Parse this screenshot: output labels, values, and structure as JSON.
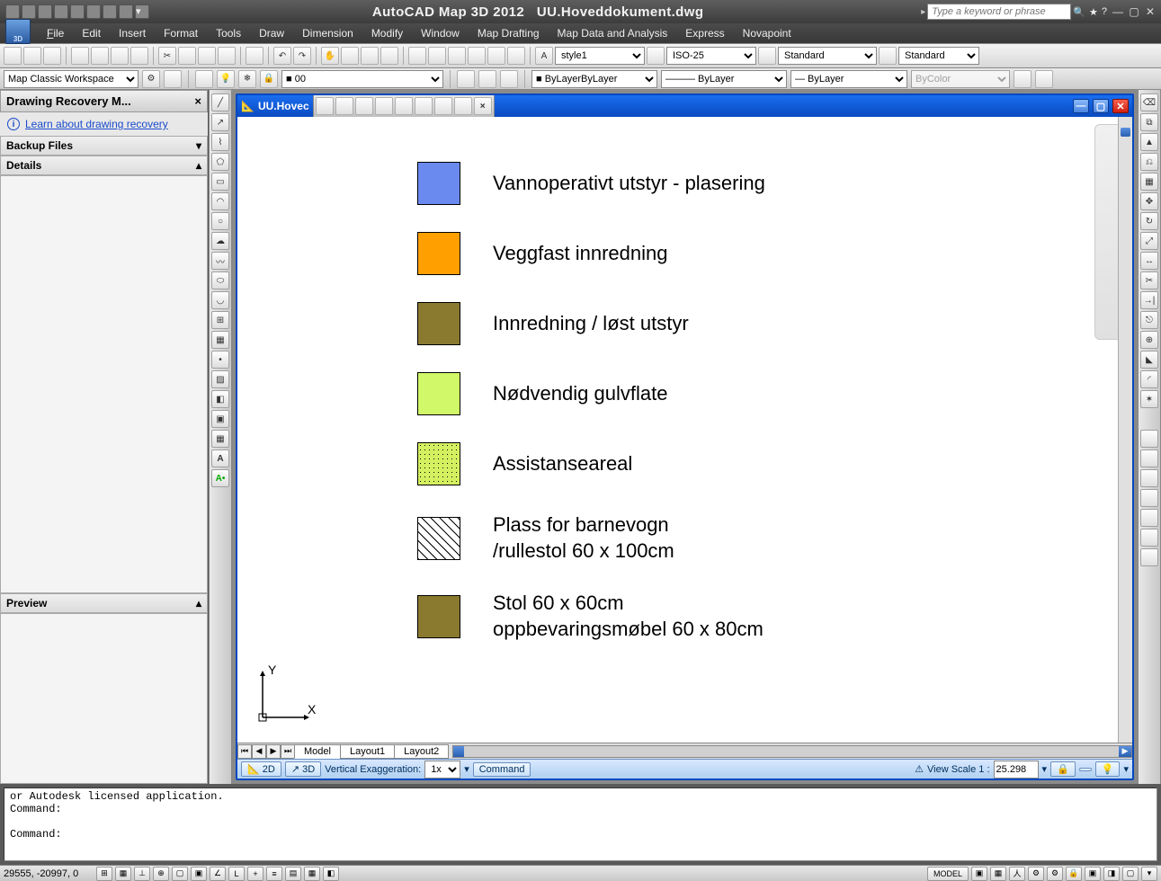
{
  "app": {
    "title_app": "AutoCAD Map 3D 2012",
    "title_file": "UU.Hoveddokument.dwg",
    "search_placeholder": "Type a keyword or phrase",
    "logo3d": "3D"
  },
  "menu": {
    "file": "File",
    "edit": "Edit",
    "insert": "Insert",
    "format": "Format",
    "tools": "Tools",
    "draw": "Draw",
    "dimension": "Dimension",
    "modify": "Modify",
    "window": "Window",
    "map_drafting": "Map Drafting",
    "map_data": "Map Data and Analysis",
    "express": "Express",
    "novapoint": "Novapoint"
  },
  "toolbar2": {
    "text_style": "style1",
    "dim_style": "ISO-25",
    "table_style": "Standard",
    "mleader_style": "Standard"
  },
  "workspace": {
    "name": "Map Classic Workspace",
    "layer_value": "0",
    "layer_control": "ByLayer",
    "linetype": "ByLayer",
    "lineweight": "ByLayer",
    "plot_style": "ByColor"
  },
  "left_panel": {
    "title": "Drawing Recovery M...",
    "link": "Learn about drawing recovery",
    "backup": "Backup Files",
    "details": "Details",
    "preview": "Preview"
  },
  "drawing_window": {
    "title": "UU.Hovec",
    "ucs_y": "Y",
    "ucs_x": "X"
  },
  "legend": {
    "items": [
      {
        "color": "#6a8af0",
        "text": "Vannoperativt utstyr - plasering"
      },
      {
        "color": "#ffa000",
        "text": "Veggfast innredning"
      },
      {
        "color": "#8a7a30",
        "text": "Innredning / løst utstyr"
      },
      {
        "color": "#d0f868",
        "text": "Nødvendig gulvflate"
      },
      {
        "pattern": "dots",
        "text": "Assistanseareal"
      },
      {
        "pattern": "diag",
        "text": "Plass for barnevogn\n/rullestol 60 x 100cm"
      },
      {
        "color": "#8a7a30",
        "text": "Stol 60 x 60cm\noppbevaringsmøbel 60 x 80cm"
      }
    ]
  },
  "layout_tabs": {
    "model": "Model",
    "layout1": "Layout1",
    "layout2": "Layout2"
  },
  "view_controls": {
    "mode2d": "2D",
    "mode3d": "3D",
    "vert_exag_label": "Vertical Exaggeration:",
    "vert_exag_value": "1x",
    "command_btn": "Command",
    "view_scale_label": "View Scale  1 :",
    "view_scale_value": "25.298"
  },
  "command": {
    "line1": "or Autodesk licensed application.",
    "line2": "Command:",
    "line3": "Command:"
  },
  "statusbar": {
    "coords": "29555, -20997, 0",
    "model_label": "MODEL"
  }
}
